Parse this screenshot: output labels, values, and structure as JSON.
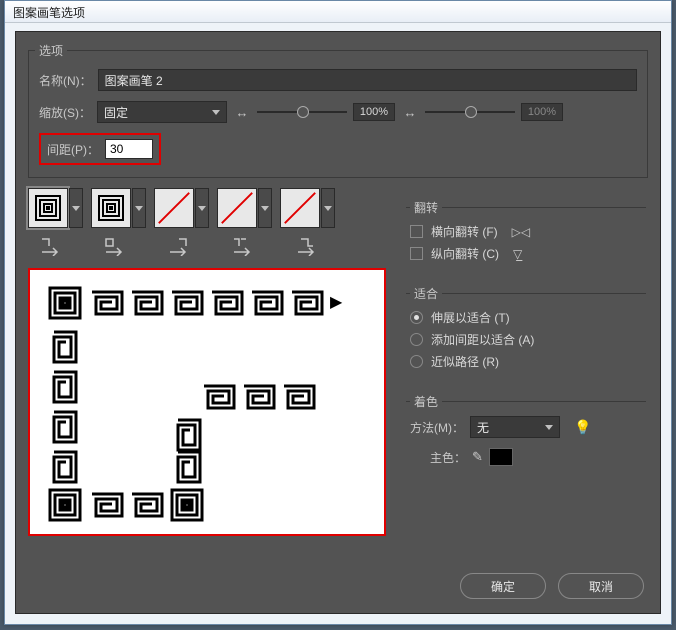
{
  "window": {
    "title": "图案画笔选项"
  },
  "options": {
    "legend": "选项",
    "name_label": "名称(N)：",
    "name_value": "图案画笔 2",
    "scale_label": "缩放(S)：",
    "scale_mode": "固定",
    "scale_value1": "100%",
    "scale_value2": "100%",
    "spacing_label": "间距(P)：",
    "spacing_value": "30"
  },
  "flip": {
    "legend": "翻转",
    "horizontal": "横向翻转 (F)",
    "vertical": "纵向翻转 (C)"
  },
  "fit": {
    "legend": "适合",
    "stretch": "伸展以适合 (T)",
    "add_space": "添加间距以适合 (A)",
    "approx": "近似路径 (R)"
  },
  "colorize": {
    "legend": "着色",
    "method_label": "方法(M)：",
    "method_value": "无",
    "keycolor_label": "主色："
  },
  "buttons": {
    "ok": "确定",
    "cancel": "取消"
  }
}
